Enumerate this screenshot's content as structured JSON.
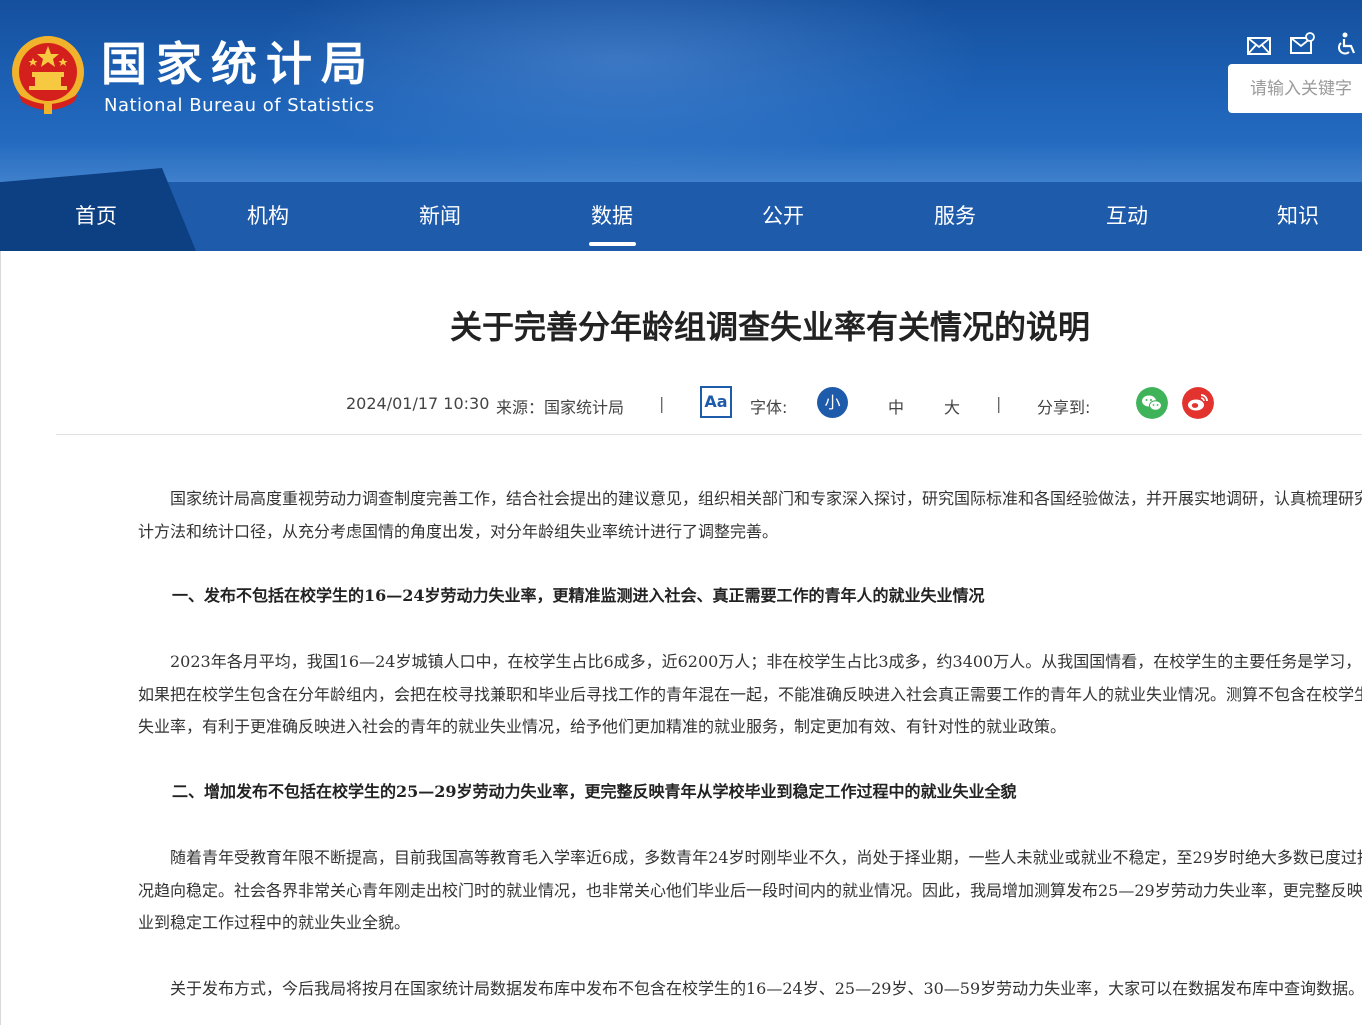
{
  "header": {
    "logo_cn": "国家统计局",
    "logo_en": "National Bureau of Statistics",
    "search_placeholder": "请输入关键字",
    "icons": [
      "mail-icon",
      "mail-subscribe-icon",
      "accessibility-icon"
    ]
  },
  "nav": {
    "items": [
      {
        "label": "首页"
      },
      {
        "label": "机构"
      },
      {
        "label": "新闻"
      },
      {
        "label": "数据"
      },
      {
        "label": "公开"
      },
      {
        "label": "服务"
      },
      {
        "label": "互动"
      },
      {
        "label": "知识"
      }
    ],
    "active": "数据"
  },
  "article": {
    "title": "关于完善分年龄组调查失业率有关情况的说明",
    "date": "2024/01/17 10:30",
    "source": "来源：国家统计局",
    "sep": "|",
    "aa": "Aa",
    "font_label": "字体:",
    "font_small": "小",
    "font_medium": "中",
    "font_large": "大",
    "share_label": "分享到:",
    "p1": [
      "国家统计局高度重视劳动力调查制度完善工作，结合社会提出的建议意见，组织相关部门和专家深入探讨，研究国际标准和各国经验做法，并开展实地调研，认真梳理研究",
      "计方法和统计口径，从充分考虑国情的角度出发，对分年龄组失业率统计进行了调整完善。"
    ],
    "h1": "一、发布不包括在校学生的16—24岁劳动力失业率，更精准监测进入社会、真正需要工作的青年人的就业失业情况",
    "p2": [
      "2023年各月平均，我国16—24岁城镇人口中，在校学生占比6成多，近6200万人；非在校学生占比3成多，约3400万人。从我国国情看，在校学生的主要任务是学习，而不是",
      "如果把在校学生包含在分年龄组内，会把在校寻找兼职和毕业后寻找工作的青年混在一起，不能准确反映进入社会真正需要工作的青年人的就业失业情况。测算不包含在校学生",
      "失业率，有利于更准确反映进入社会的青年的就业失业情况，给予他们更加精准的就业服务，制定更加有效、有针对性的就业政策。"
    ],
    "h2": "二、增加发布不包括在校学生的25—29岁劳动力失业率，更完整反映青年从学校毕业到稳定工作过程中的就业失业全貌",
    "p3": [
      "随着青年受教育年限不断提高，目前我国高等教育毛入学率近6成，多数青年24岁时刚毕业不久，尚处于择业期，一些人未就业或就业不稳定，至29岁时绝大多数已度过择业",
      "况趋向稳定。社会各界非常关心青年刚走出校门时的就业情况，也非常关心他们毕业后一段时间内的就业情况。因此，我局增加测算发布25—29岁劳动力失业率，更完整反映青",
      "业到稳定工作过程中的就业失业全貌。"
    ],
    "p4": [
      "关于发布方式，今后我局将按月在国家统计局数据发布库中发布不包含在校学生的16—24岁、25—29岁、30—59岁劳动力失业率，大家可以在数据发布库中查询数据。"
    ]
  },
  "colors": {
    "nav_bg": "#1f5bab",
    "nav_active_bg": "#0d3f83",
    "wechat": "#3fb35a",
    "weibo": "#e2332f"
  }
}
